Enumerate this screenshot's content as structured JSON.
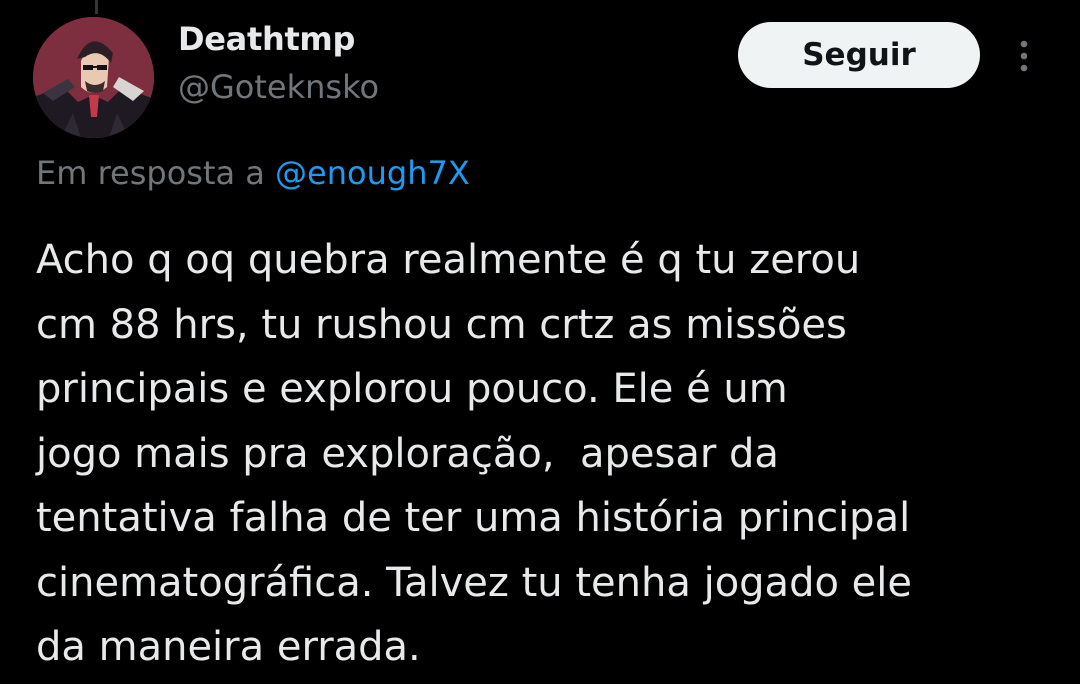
{
  "author": {
    "display_name": "Deathtmp",
    "handle": "@Goteknsko",
    "avatar_icon": "illustrated-avatar"
  },
  "actions": {
    "follow_label": "Seguir",
    "more_icon": "more-vertical-icon"
  },
  "reply_context": {
    "prefix": "Em resposta a",
    "mention": "@enough7X"
  },
  "tweet": {
    "lines": [
      "Acho q oq quebra realmente é q tu zerou",
      "cm 88 hrs, tu rushou cm crtz as missões",
      "principais e explorou pouco. Ele é um",
      "jogo mais pra exploração,  apesar da",
      "tentativa falha de ter uma história principal",
      "cinematográfica. Talvez tu tenha jogado ele",
      "da maneira errada."
    ]
  },
  "colors": {
    "background": "#000000",
    "primary_text": "#e7e9ea",
    "secondary_text": "#71767b",
    "link": "#1d9bf0",
    "button_bg": "#eff3f4",
    "button_text": "#0f1419",
    "avatar_bg": "#7d2f3f"
  }
}
